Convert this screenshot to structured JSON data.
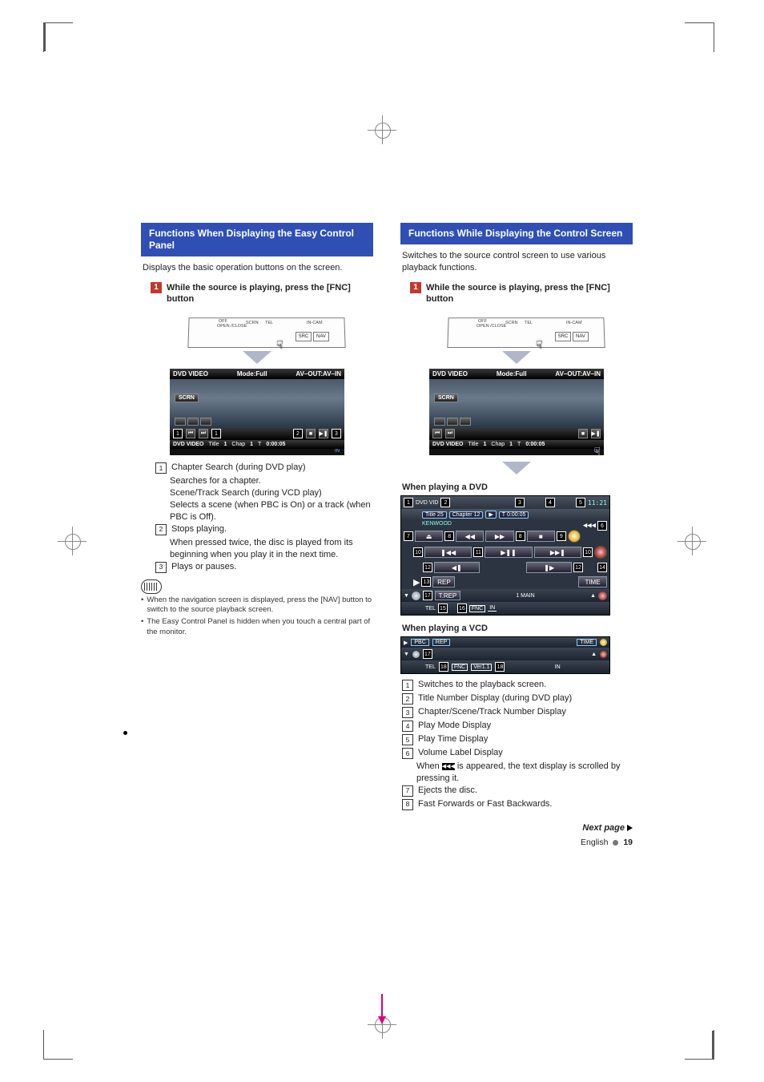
{
  "left": {
    "heading": "Functions When Displaying the Easy Control Panel",
    "intro": "Displays the basic operation buttons on the screen.",
    "step1": "While the source is playing, press the [FNC] button",
    "device": {
      "off": "OFF",
      "open": "OPEN /CLOSE",
      "scrn": "SCRN",
      "tel": "TEL",
      "incam": "IN-CAM",
      "src": "SRC",
      "nav": "NAV"
    },
    "shot": {
      "title": "DVD VIDEO",
      "mode": "Mode:Full",
      "avout": "AV–OUT:AV–IN",
      "scrn": "SCRN",
      "bottom_title": "DVD VIDEO",
      "title_lbl": "Title",
      "title_no": "1",
      "chap_lbl": "Chap",
      "chap_no": "1",
      "t_lbl": "T",
      "time": "0:00:05",
      "in": "IN"
    },
    "list": {
      "i1a": "Chapter Search (during DVD play)",
      "i1b": "Searches for a chapter.",
      "i1c": "Scene/Track Search (during VCD play)",
      "i1d": "Selects a scene (when PBC is On) or a track (when PBC is Off).",
      "i2a": "Stops playing.",
      "i2b": "When pressed twice, the disc is played from its beginning when you play it in the next time.",
      "i3": "Plays or pauses."
    },
    "notes": {
      "n1": "When the navigation screen is displayed, press the [NAV] button to switch to the source playback screen.",
      "n2": "The Easy Control Panel is hidden when you touch a central part of the monitor."
    }
  },
  "right": {
    "heading": "Functions While Displaying the Control Screen",
    "intro": "Switches to the source control screen to use various playback functions.",
    "step1": "While the source is playing, press the [FNC] button",
    "sub_dvd": "When playing a DVD",
    "sub_vcd": "When playing a VCD",
    "dvd": {
      "src": "DVD VID",
      "title_lbl": "Title",
      "title_no": "25",
      "chap_lbl": "Chapter",
      "chap_no": "12",
      "t_lbl": "T",
      "time": "0:00:05",
      "clock": "11:21",
      "album": "KENWOOD",
      "rep": "REP",
      "trep": "T.REP",
      "main": "1 MAIN",
      "time_btn": "TIME",
      "tel": "TEL",
      "fnc": "FNC",
      "in": "IN"
    },
    "vcd": {
      "pbc": "PBC",
      "rep": "REP",
      "time": "TIME",
      "tel": "TEL",
      "fnc": "FNC",
      "ver": "Ver1.1",
      "in": "IN"
    },
    "list": {
      "i1": "Switches to the playback screen.",
      "i2": "Title Number Display (during DVD play)",
      "i3": "Chapter/Scene/Track Number Display",
      "i4": "Play Mode Display",
      "i5": "Play Time Display",
      "i6a": "Volume Label Display",
      "i6b_pre": "When ",
      "i6b_post": " is appeared, the text display is scrolled by pressing it.",
      "i7": "Ejects the disc.",
      "i8": "Fast Forwards or Fast Backwards."
    },
    "next": "Next page",
    "footer_lang": "English",
    "footer_page": "19"
  },
  "callouts": {
    "n1": "1",
    "n2": "2",
    "n3": "3",
    "n4": "4",
    "n5": "5",
    "n6": "6",
    "n7": "7",
    "n8": "8",
    "n9": "9",
    "n10": "10",
    "n11": "11",
    "n12": "12",
    "n13": "13",
    "n14": "14",
    "n15": "15",
    "n16": "16",
    "n17": "17",
    "n18": "18"
  }
}
